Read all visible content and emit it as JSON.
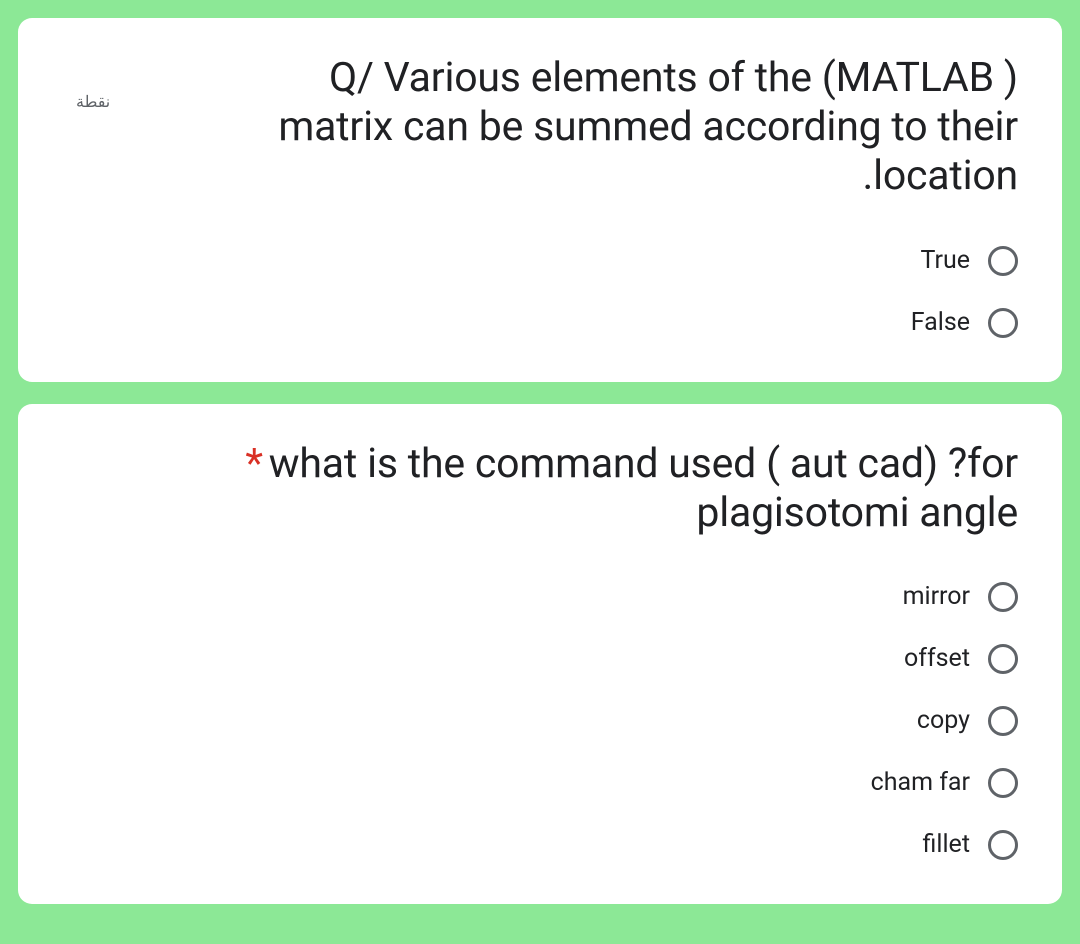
{
  "questions": [
    {
      "points_label": "نقطة",
      "required": false,
      "text": "Q/  Various elements of the  (MATLAB ) matrix can be summed according to their .location",
      "options": [
        "True",
        "False"
      ]
    },
    {
      "points_label": "",
      "required": true,
      "text": "what is the command used  (  aut cad) ?for plagisotomi angle",
      "options": [
        "mirror",
        "offset",
        "copy",
        "cham far",
        "fillet"
      ]
    }
  ]
}
